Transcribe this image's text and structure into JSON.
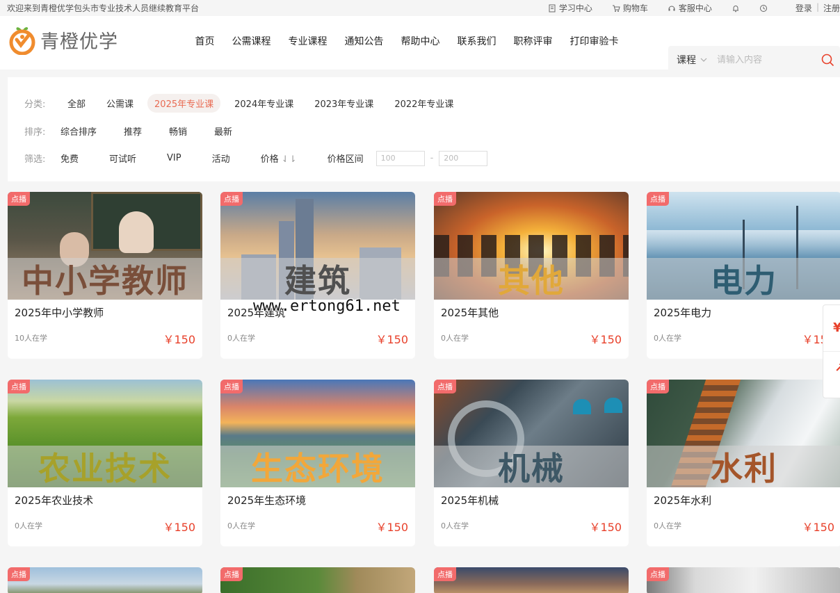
{
  "topbar": {
    "welcome": "欢迎来到青橙优学包头市专业技术人员继续教育平台",
    "links": [
      {
        "label": "学习中心",
        "icon": "document-icon"
      },
      {
        "label": "购物车",
        "icon": "cart-icon"
      },
      {
        "label": "客服中心",
        "icon": "headset-icon"
      }
    ],
    "bell_icon": "bell-icon",
    "history_icon": "history-icon",
    "login": "登录",
    "register": "注册"
  },
  "header": {
    "logo_text": "青橙优学",
    "brand_color": "#f08c2e",
    "nav": [
      "首页",
      "公需课程",
      "专业课程",
      "通知公告",
      "帮助中心",
      "联系我们",
      "职称评审",
      "打印审验卡"
    ],
    "search_type": "课程",
    "search_placeholder": "请输入内容"
  },
  "filters": {
    "category_label": "分类:",
    "categories": [
      "全部",
      "公需课",
      "2025年专业课",
      "2024年专业课",
      "2023年专业课",
      "2022年专业课"
    ],
    "active_category": "2025年专业课",
    "sort_label": "排序:",
    "sorts": [
      "综合排序",
      "推荐",
      "畅销",
      "最新"
    ],
    "filter_label": "筛选:",
    "filter_items": [
      "免费",
      "可试听",
      "VIP",
      "活动"
    ],
    "price_label": "价格",
    "price_range_label": "价格区间",
    "price_min_placeholder": "100",
    "price_max_placeholder": "200",
    "range_dash": "-"
  },
  "courses": [
    {
      "tag": "点播",
      "banner": "中小学教师",
      "banner_color": "#7a4f3a",
      "title": "2025年中小学教师",
      "learners": "10人在学",
      "price": "￥150"
    },
    {
      "tag": "点播",
      "banner": "建筑",
      "banner_color": "#505050",
      "title": "2025年建筑",
      "learners": "0人在学",
      "price": "￥150"
    },
    {
      "tag": "点播",
      "banner": "其他",
      "banner_color": "#e1a83a",
      "title": "2025年其他",
      "learners": "0人在学",
      "price": "￥150"
    },
    {
      "tag": "点播",
      "banner": "电力",
      "banner_color": "#2e5d72",
      "title": "2025年电力",
      "learners": "0人在学",
      "price": "￥150"
    },
    {
      "tag": "点播",
      "banner": "农业技术",
      "banner_color": "#a7a12a",
      "title": "2025年农业技术",
      "learners": "0人在学",
      "price": "￥150"
    },
    {
      "tag": "点播",
      "banner": "生态环境",
      "banner_color": "#f2a73a",
      "title": "2025年生态环境",
      "learners": "0人在学",
      "price": "￥150"
    },
    {
      "tag": "点播",
      "banner": "机械",
      "banner_color": "#3e5866",
      "title": "2025年机械",
      "learners": "0人在学",
      "price": "￥150"
    },
    {
      "tag": "点播",
      "banner": "水利",
      "banner_color": "#a4552a",
      "title": "2025年水利",
      "learners": "0人在学",
      "price": "￥150"
    },
    {
      "tag": "点播"
    },
    {
      "tag": "点播"
    },
    {
      "tag": "点播"
    },
    {
      "tag": "点播"
    }
  ],
  "watermark": "www.ertong61.net",
  "price_color": "#e8412b",
  "accent_color": "#e96b53"
}
